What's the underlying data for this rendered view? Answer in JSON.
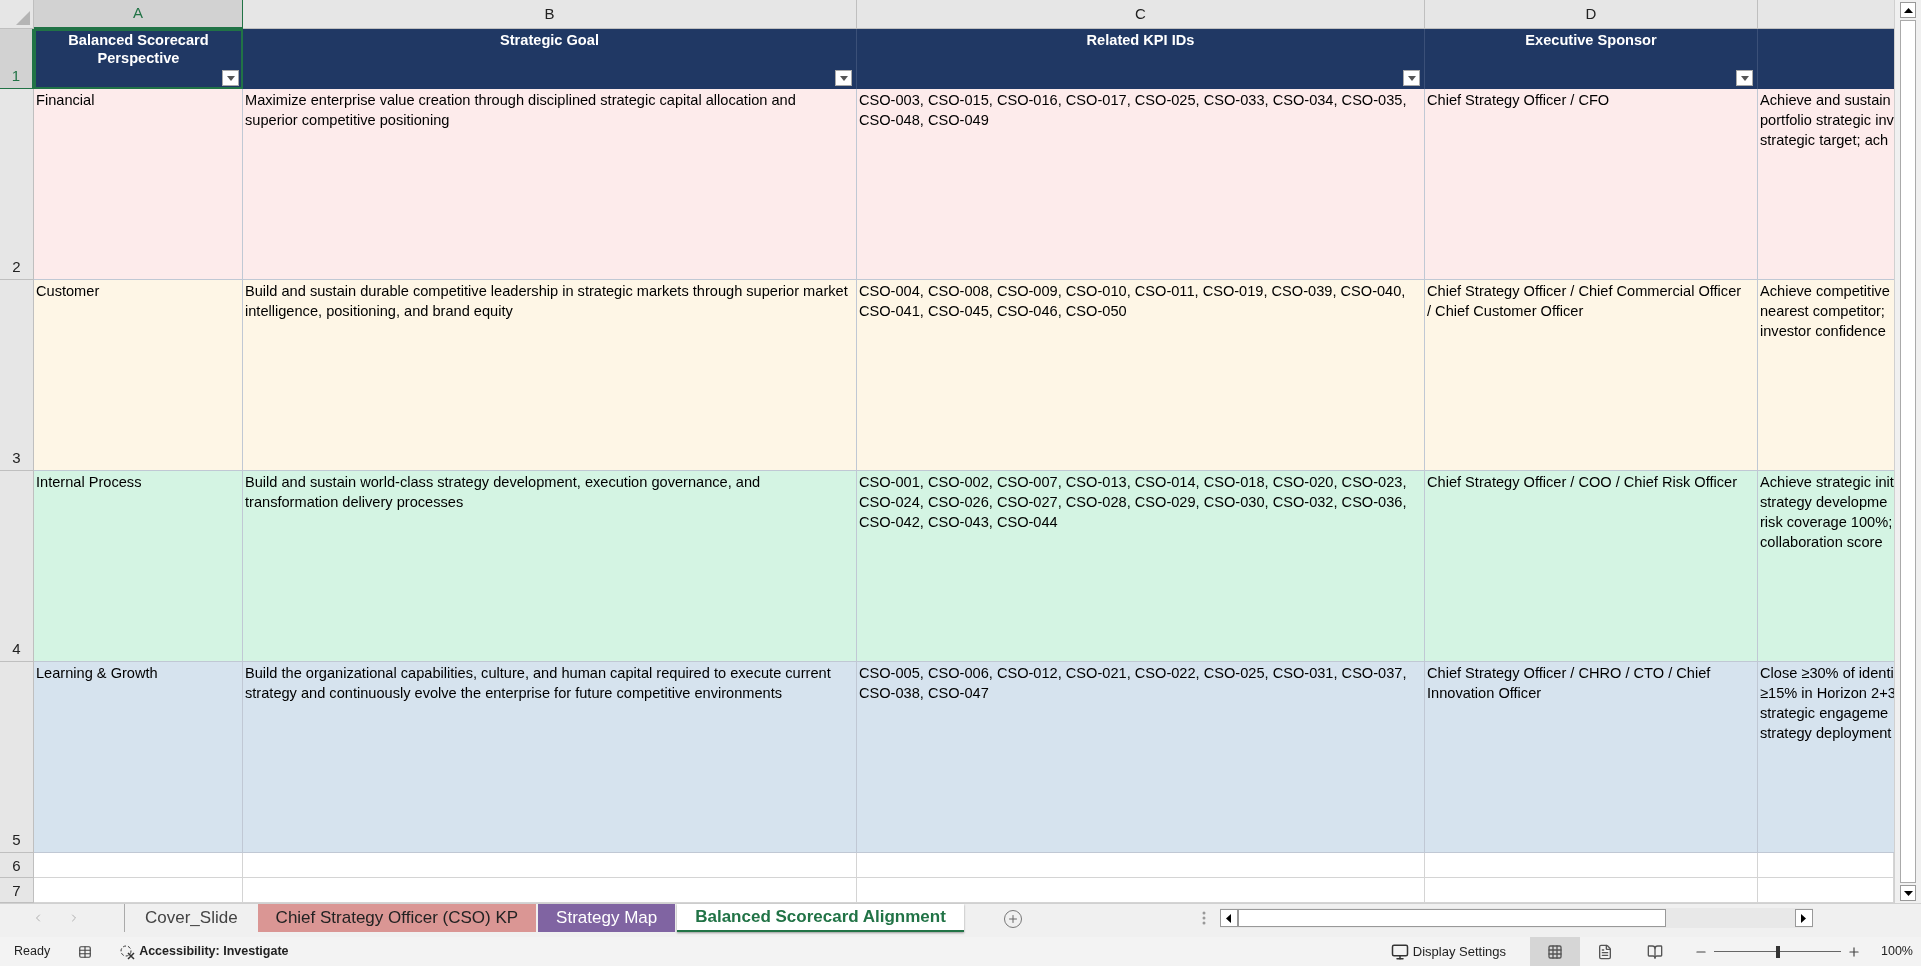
{
  "columns": [
    {
      "letter": "A",
      "selected": true,
      "header": "Balanced Scorecard Perspective"
    },
    {
      "letter": "B",
      "selected": false,
      "header": "Strategic Goal"
    },
    {
      "letter": "C",
      "selected": false,
      "header": "Related KPI IDs"
    },
    {
      "letter": "D",
      "selected": false,
      "header": "Executive Sponsor"
    }
  ],
  "header_row": {
    "number": "1",
    "selected": true
  },
  "rows": [
    {
      "number": "2",
      "color": "#fdebeb",
      "perspective": "Financial",
      "goal": "Maximize enterprise value creation through disciplined strategic capital allocation and superior competitive positioning",
      "kpi_ids": "CSO-003, CSO-015, CSO-016, CSO-017, CSO-025, CSO-033, CSO-034, CSO-035, CSO-048, CSO-049",
      "sponsor": "Chief Strategy Officer / CFO",
      "column_5": [
        "Achieve and sustain",
        "portfolio strategic inv",
        "strategic target; ach"
      ]
    },
    {
      "number": "3",
      "color": "#fef6e6",
      "perspective": "Customer",
      "goal": "Build and sustain durable competitive leadership in strategic markets through superior market intelligence, positioning, and brand equity",
      "kpi_ids": "CSO-004, CSO-008, CSO-009, CSO-010, CSO-011, CSO-019, CSO-039, CSO-040, CSO-041, CSO-045, CSO-046, CSO-050",
      "sponsor": "Chief Strategy Officer / Chief Commercial Officer / Chief Customer Officer",
      "column_5": [
        "Achieve competitive",
        "nearest competitor;",
        "investor confidence"
      ]
    },
    {
      "number": "4",
      "color": "#d4f4e3",
      "perspective": "Internal Process",
      "goal": "Build and sustain world-class strategy development, execution governance, and transformation delivery processes",
      "kpi_ids": "CSO-001, CSO-002, CSO-007, CSO-013, CSO-014, CSO-018, CSO-020, CSO-023, CSO-024, CSO-026, CSO-027, CSO-028, CSO-029, CSO-030, CSO-032, CSO-036, CSO-042, CSO-043, CSO-044",
      "sponsor": "Chief Strategy Officer / COO / Chief Risk Officer",
      "column_5": [
        "Achieve strategic init",
        "strategy developme",
        "risk coverage 100%;",
        "collaboration score"
      ]
    },
    {
      "number": "5",
      "color": "#d6e3ee",
      "perspective": "Learning & Growth",
      "goal": "Build the organizational capabilities, culture, and human capital required to execute current strategy and continuously evolve the enterprise for future competitive environments",
      "kpi_ids": "CSO-005, CSO-006, CSO-012, CSO-021, CSO-022, CSO-025, CSO-031, CSO-037, CSO-038, CSO-047",
      "sponsor": "Chief Strategy Officer / CHRO / CTO / Chief Innovation Officer",
      "column_5": [
        "Close ≥30% of identi",
        "≥15% in Horizon 2+3",
        "strategic engageme",
        "strategy deployment"
      ]
    }
  ],
  "empty_rows": [
    "6",
    "7"
  ],
  "sheet_tabs": [
    {
      "label": "Cover_Slide",
      "selected": false
    },
    {
      "label": "Chief Strategy Officer (CSO) KP",
      "color": "#da9694",
      "selected": false
    },
    {
      "label": "Strategy Map",
      "color": "#8064a2",
      "selected": false
    },
    {
      "label": "Balanced Scorecard Alignment",
      "selected": true
    }
  ],
  "status_bar": {
    "mode": "Ready",
    "accessibility": "Accessibility: Investigate",
    "display_settings": "Display Settings",
    "zoom": "100%",
    "zoom_slider": {
      "level": 0.5
    }
  }
}
